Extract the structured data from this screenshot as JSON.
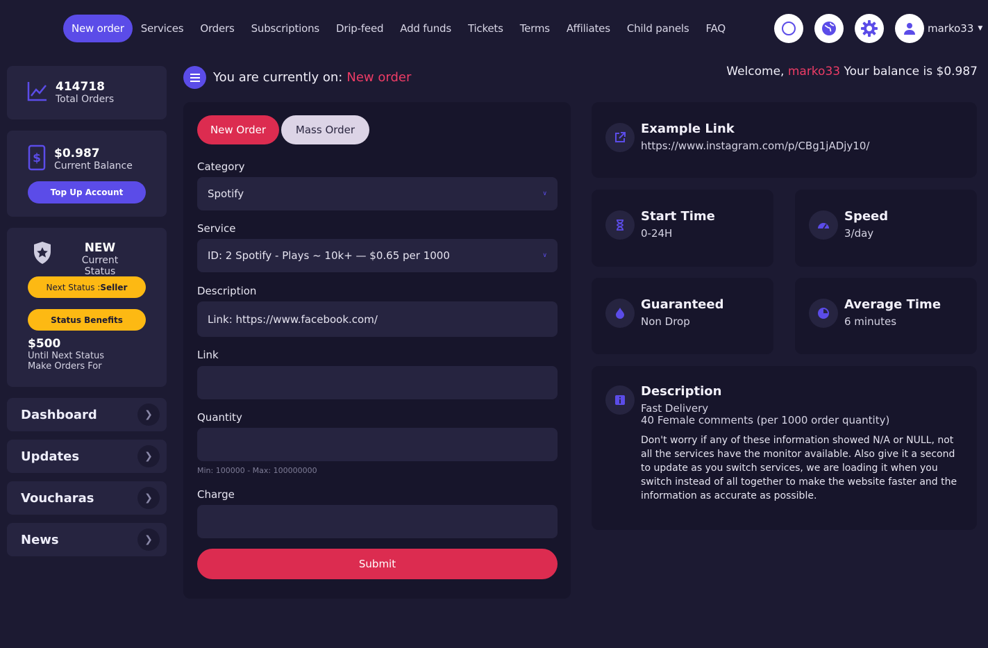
{
  "nav": {
    "items": [
      "New order",
      "Services",
      "Orders",
      "Subscriptions",
      "Drip-feed",
      "Add funds",
      "Tickets",
      "Terms",
      "Affiliates",
      "Child panels",
      "FAQ"
    ],
    "username": "marko33",
    "icons": [
      "theme-toggle-icon",
      "globe-icon",
      "settings-gear-icon",
      "user-icon"
    ]
  },
  "sidebar": {
    "total_orders": {
      "value": "414718",
      "label": "Total Orders"
    },
    "balance": {
      "value": "$0.987",
      "label": "Current Balance",
      "button": "Top Up Account"
    },
    "status": {
      "name": "NEW",
      "label": "Current Status",
      "next_prefix": "Next Status : ",
      "next_value": "Seller",
      "benefits_button": "Status Benefits",
      "amount": "$500",
      "line1": "Until Next Status",
      "line2": "Make Orders For"
    },
    "menu": [
      "Dashboard",
      "Updates",
      "Voucharas",
      "News"
    ]
  },
  "header": {
    "crumb_prefix": "You are currently on:",
    "crumb_page": "New order",
    "welcome_prefix": "Welcome,",
    "welcome_user": "marko33",
    "welcome_suffix": "Your balance is $0.987"
  },
  "form": {
    "tabs": [
      "New Order",
      "Mass Order"
    ],
    "category_label": "Category",
    "category_value": "Spotify",
    "service_label": "Service",
    "service_value": "ID: 2 Spotify - Plays ~ 10k+ — $0.65 per 1000",
    "description_label": "Description",
    "description_value": "Link: https://www.facebook.com/",
    "link_label": "Link",
    "link_value": "",
    "quantity_label": "Quantity",
    "quantity_value": "",
    "quantity_hint": "Min: 100000 - Max: 100000000",
    "charge_label": "Charge",
    "charge_value": "",
    "submit": "Submit"
  },
  "info": {
    "example": {
      "title": "Example Link",
      "value": "https://www.instagram.com/p/CBg1jADjy10/"
    },
    "start_time": {
      "title": "Start Time",
      "value": "0-24H"
    },
    "speed": {
      "title": "Speed",
      "value": "3/day"
    },
    "guaranteed": {
      "title": "Guaranteed",
      "value": "Non Drop"
    },
    "average_time": {
      "title": "Average Time",
      "value": "6 minutes"
    },
    "description": {
      "title": "Description",
      "line1": "Fast Delivery",
      "line2": "40 Female comments (per 1000 order quantity)",
      "body": "Don't worry if any of these information showed N/A or NULL, not all the services have the monitor available. Also give it a second to update as you switch services, we are loading it when you switch instead of all together to make the website faster and the information as accurate as possible."
    }
  },
  "colors": {
    "background": "#1c1a32",
    "card": "#262440",
    "panel": "#17152b",
    "accent_purple": "#5b4ce8",
    "accent_red": "#dc2c50",
    "accent_yellow": "#fdb913",
    "highlight_pink": "#ee3c66"
  }
}
